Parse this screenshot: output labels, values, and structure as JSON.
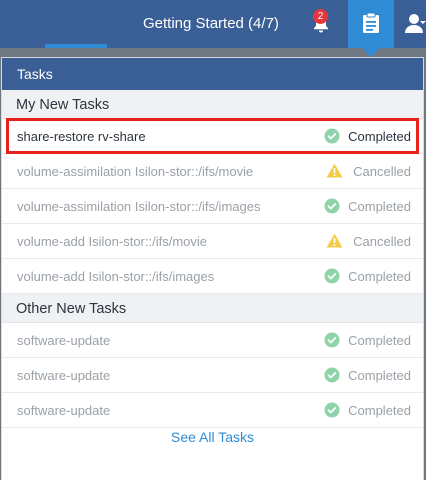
{
  "topbar": {
    "getting_started": "Getting Started (4/7)",
    "notification_count": "2"
  },
  "panel": {
    "title": "Tasks",
    "my_new_tasks": {
      "heading": "My New Tasks",
      "rows": [
        {
          "name": "share-restore rv-share",
          "status": "Completed",
          "icon": "check-circle-icon"
        },
        {
          "name": "volume-assimilation Isilon-stor::/ifs/movie",
          "status": "Cancelled",
          "icon": "warning-icon"
        },
        {
          "name": "volume-assimilation Isilon-stor::/ifs/images",
          "status": "Completed",
          "icon": "check-circle-icon"
        },
        {
          "name": "volume-add Isilon-stor::/ifs/movie",
          "status": "Cancelled",
          "icon": "warning-icon"
        },
        {
          "name": "volume-add Isilon-stor::/ifs/images",
          "status": "Completed",
          "icon": "check-circle-icon"
        }
      ]
    },
    "other_new_tasks": {
      "heading": "Other New Tasks",
      "rows": [
        {
          "name": "software-update",
          "status": "Completed",
          "icon": "check-circle-icon"
        },
        {
          "name": "software-update",
          "status": "Completed",
          "icon": "check-circle-icon"
        },
        {
          "name": "software-update",
          "status": "Completed",
          "icon": "check-circle-icon"
        }
      ]
    },
    "see_all": "See All Tasks"
  },
  "colors": {
    "header": "#3a5f97",
    "accent": "#2f8bd3",
    "completed": "#8fd4a9",
    "cancelled": "#f4cc4a",
    "highlight": "#e8221b"
  }
}
